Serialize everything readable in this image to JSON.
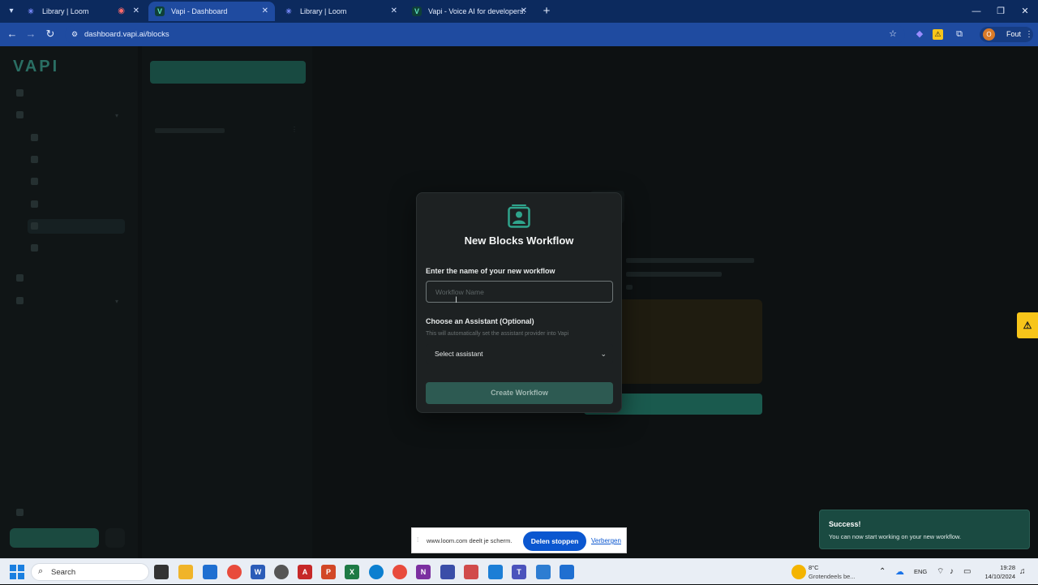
{
  "browser": {
    "tabs": [
      {
        "title": "Library | Loom",
        "active": false
      },
      {
        "title": "Vapi - Dashboard",
        "active": true
      },
      {
        "title": "Library | Loom",
        "active": false
      },
      {
        "title": "Vapi - Voice AI for developers.",
        "active": false
      }
    ],
    "url": "dashboard.vapi.ai/blocks",
    "profile_label": "Fout",
    "profile_initial": "O"
  },
  "app": {
    "logo": "VAPI"
  },
  "modal": {
    "title": "New Blocks Workflow",
    "name_label": "Enter the name of your new workflow",
    "name_placeholder": "Workflow Name",
    "assistant_label": "Choose an Assistant (Optional)",
    "assistant_helper": "This will automatically set the assistant provider into Vapi",
    "assistant_select": "Select assistant",
    "create_button": "Create Workflow"
  },
  "toast": {
    "title": "Success!",
    "message": "You can now start working on your new workflow."
  },
  "share_bar": {
    "text": "www.loom.com deelt je scherm.",
    "stop_label": "Delen stoppen",
    "hide_label": "Verbergen"
  },
  "taskbar": {
    "search_label": "Search",
    "weather_temp": "8°C",
    "weather_desc": "Grotendeels be...",
    "language": "ENG",
    "time": "19:28",
    "date": "14/10/2024"
  },
  "colors": {
    "accent": "#2d5a52",
    "browser_frame": "#1f4ba0",
    "modal_bg": "#1d2122"
  }
}
